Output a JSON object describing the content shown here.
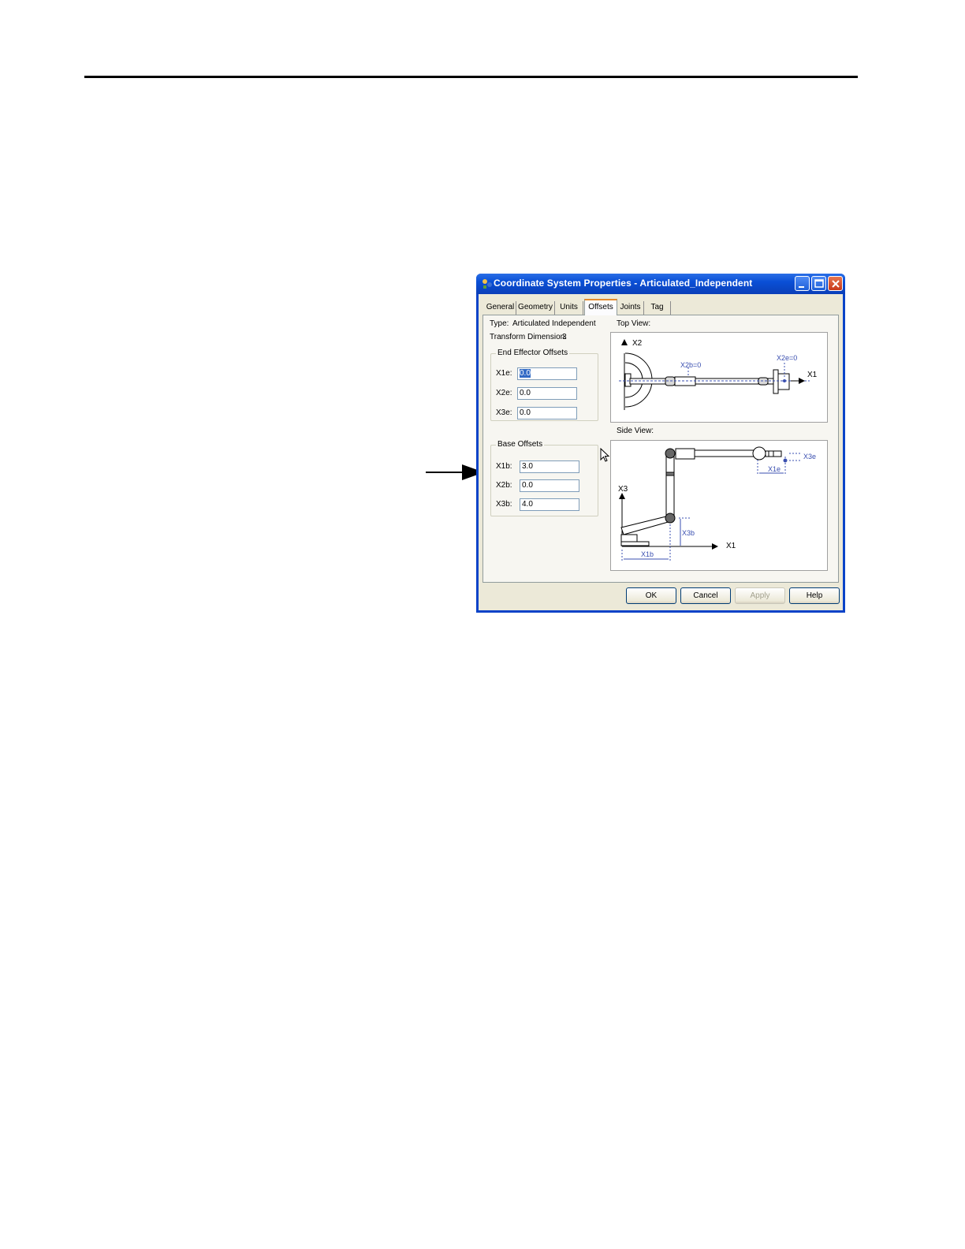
{
  "window": {
    "title": "Coordinate System Properties - Articulated_Independent"
  },
  "tabs": [
    {
      "label": "General"
    },
    {
      "label": "Geometry"
    },
    {
      "label": "Units"
    },
    {
      "label": "Offsets",
      "active": true
    },
    {
      "label": "Joints"
    },
    {
      "label": "Tag"
    }
  ],
  "info": {
    "type_label": "Type:",
    "type_value": "Articulated Independent",
    "transform_label": "Transform Dimension:",
    "transform_value": "3"
  },
  "end_effector": {
    "title": "End Effector Offsets",
    "fields": [
      {
        "label": "X1e:",
        "value": "0.0",
        "selected": true
      },
      {
        "label": "X2e:",
        "value": "0.0"
      },
      {
        "label": "X3e:",
        "value": "0.0"
      }
    ]
  },
  "base": {
    "title": "Base Offsets",
    "fields": [
      {
        "label": "X1b:",
        "value": "3.0"
      },
      {
        "label": "X2b:",
        "value": "0.0"
      },
      {
        "label": "X3b:",
        "value": "4.0"
      }
    ]
  },
  "top_view": {
    "title": "Top View:",
    "labels": {
      "x2": "X2",
      "x1": "X1",
      "x2b": "X2b=0",
      "x2e": "X2e=0"
    }
  },
  "side_view": {
    "title": "Side View:",
    "labels": {
      "x3": "X3",
      "x1": "X1",
      "x3b": "X3b",
      "x1b": "X1b",
      "x1e": "X1e",
      "x3e": "X3e"
    }
  },
  "buttons": {
    "ok": "OK",
    "cancel": "Cancel",
    "apply": "Apply",
    "help": "Help"
  },
  "colors": {
    "titlebar": "#0a4fd6",
    "dialog_face": "#ece9d8",
    "dimension_blue": "#3a4fb0"
  }
}
